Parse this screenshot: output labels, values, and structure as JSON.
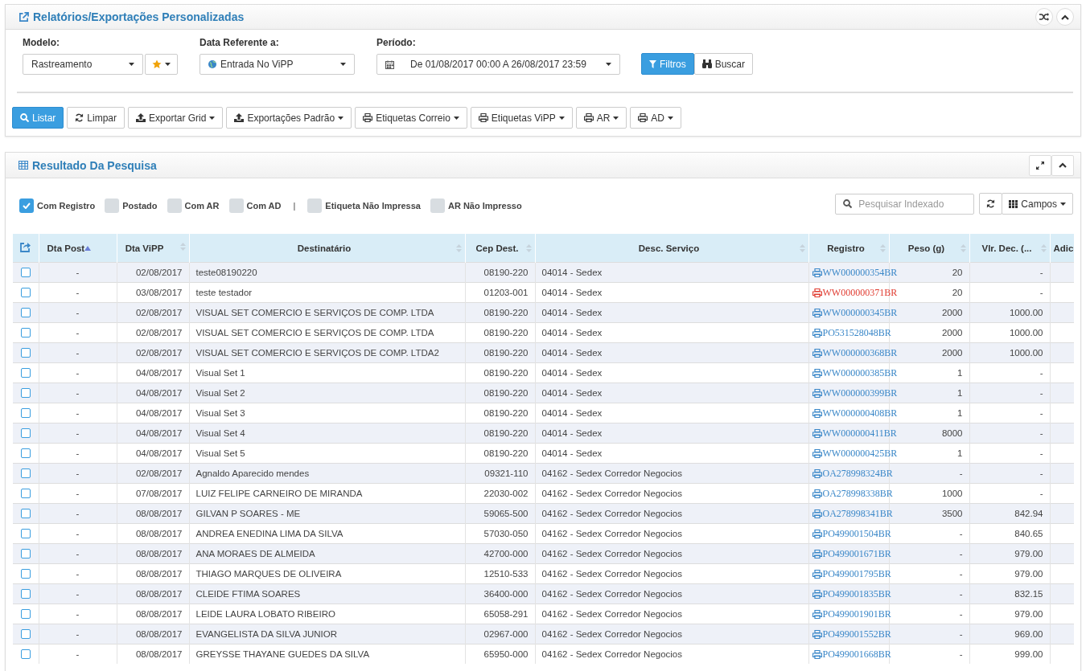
{
  "report_panel": {
    "title": "Relatórios/Exportações Personalizadas",
    "fields": [
      {
        "label": "Modelo:",
        "value": "Rastreamento"
      },
      {
        "label": "Data Referente a:",
        "value": "Entrada No ViPP"
      },
      {
        "label": "Período:",
        "value": "De 01/08/2017 00:00 A 26/08/2017 23:59"
      }
    ],
    "filter_buttons": [
      {
        "label": "Filtros",
        "active": true
      },
      {
        "label": "Buscar",
        "active": false
      }
    ],
    "toolbar": [
      {
        "label": "Listar",
        "active": true,
        "caret": false
      },
      {
        "label": "Limpar",
        "active": false,
        "caret": false
      },
      {
        "label": "Exportar Grid",
        "active": false,
        "caret": true
      },
      {
        "label": "Exportações Padrão",
        "active": false,
        "caret": true
      },
      {
        "label": "Etiquetas Correio",
        "active": false,
        "caret": true
      },
      {
        "label": "Etiquetas ViPP",
        "active": false,
        "caret": true
      },
      {
        "label": "AR",
        "active": false,
        "caret": true
      },
      {
        "label": "AD",
        "active": false,
        "caret": true
      }
    ]
  },
  "result_panel": {
    "title": "Resultado Da Pesquisa",
    "filters": [
      {
        "kind": "checkbox",
        "label": "Com Registro",
        "checked": true
      },
      {
        "kind": "checkbox",
        "label": "Postado",
        "checked": false
      },
      {
        "kind": "checkbox",
        "label": "Com AR",
        "checked": false
      },
      {
        "kind": "checkbox",
        "label": "Com AD",
        "checked": false
      },
      {
        "kind": "separator",
        "label": "|"
      },
      {
        "kind": "checkbox",
        "label": "Etiqueta Não Impressa",
        "checked": false
      },
      {
        "kind": "checkbox",
        "label": "AR Não Impresso",
        "checked": false
      }
    ],
    "search": {
      "placeholder": "Pesquisar Indexado"
    },
    "fields_button": "Campos",
    "table": {
      "columns": [
        {
          "label": "Dta Post",
          "sorted": true
        },
        {
          "label": "Dta ViPP",
          "sorted": false
        },
        {
          "label": "Destinatário",
          "sorted": false
        },
        {
          "label": "Cep Dest.",
          "sorted": false
        },
        {
          "label": "Desc. Serviço",
          "sorted": false
        },
        {
          "label": "Registro",
          "sorted": false
        },
        {
          "label": "Peso (g)",
          "sorted": false
        },
        {
          "label": "Vlr. Dec. (...",
          "sorted": false
        },
        {
          "label": "Adic",
          "sorted": false
        }
      ],
      "rows": [
        {
          "checked": false,
          "dta_post": "-",
          "dta_vipp": "02/08/2017",
          "destinatario": "teste08190220",
          "cep": "08190-220",
          "servico": "04014 - Sedex",
          "registro": "WW000000354BR",
          "color": "#3a87c8",
          "peso": "20",
          "valor": "-"
        },
        {
          "checked": false,
          "dta_post": "-",
          "dta_vipp": "03/08/2017",
          "destinatario": "teste testador",
          "cep": "01203-001",
          "servico": "04014 - Sedex",
          "registro": "WW000000371BR",
          "color": "#e03c31",
          "peso": "20",
          "valor": "-"
        },
        {
          "checked": false,
          "dta_post": "-",
          "dta_vipp": "02/08/2017",
          "destinatario": "VISUAL SET COMERCIO E SERVIÇOS DE COMP. LTDA",
          "cep": "08190-220",
          "servico": "04014 - Sedex",
          "registro": "WW000000345BR",
          "color": "#3a87c8",
          "peso": "2000",
          "valor": "1000.00"
        },
        {
          "checked": false,
          "dta_post": "-",
          "dta_vipp": "02/08/2017",
          "destinatario": "VISUAL SET COMERCIO E SERVIÇOS DE COMP. LTDA",
          "cep": "08190-220",
          "servico": "04014 - Sedex",
          "registro": "PO531528048BR",
          "color": "#3a87c8",
          "peso": "2000",
          "valor": "1000.00"
        },
        {
          "checked": false,
          "dta_post": "-",
          "dta_vipp": "02/08/2017",
          "destinatario": "VISUAL SET COMERCIO E SERVIÇOS DE COMP. LTDA2",
          "cep": "08190-220",
          "servico": "04014 - Sedex",
          "registro": "WW000000368BR",
          "color": "#3a87c8",
          "peso": "2000",
          "valor": "1000.00"
        },
        {
          "checked": false,
          "dta_post": "-",
          "dta_vipp": "04/08/2017",
          "destinatario": "Visual Set 1",
          "cep": "08190-220",
          "servico": "04014 - Sedex",
          "registro": "WW000000385BR",
          "color": "#3a87c8",
          "peso": "1",
          "valor": "-"
        },
        {
          "checked": false,
          "dta_post": "-",
          "dta_vipp": "04/08/2017",
          "destinatario": "Visual Set 2",
          "cep": "08190-220",
          "servico": "04014 - Sedex",
          "registro": "WW000000399BR",
          "color": "#3a87c8",
          "peso": "1",
          "valor": "-"
        },
        {
          "checked": false,
          "dta_post": "-",
          "dta_vipp": "04/08/2017",
          "destinatario": "Visual Set 3",
          "cep": "08190-220",
          "servico": "04014 - Sedex",
          "registro": "WW000000408BR",
          "color": "#3a87c8",
          "peso": "1",
          "valor": "-"
        },
        {
          "checked": false,
          "dta_post": "-",
          "dta_vipp": "04/08/2017",
          "destinatario": "Visual Set 4",
          "cep": "08190-220",
          "servico": "04014 - Sedex",
          "registro": "WW000000411BR",
          "color": "#3a87c8",
          "peso": "8000",
          "valor": "-"
        },
        {
          "checked": false,
          "dta_post": "-",
          "dta_vipp": "04/08/2017",
          "destinatario": "Visual Set 5",
          "cep": "08190-220",
          "servico": "04014 - Sedex",
          "registro": "WW000000425BR",
          "color": "#3a87c8",
          "peso": "1",
          "valor": "-"
        },
        {
          "checked": false,
          "dta_post": "-",
          "dta_vipp": "02/08/2017",
          "destinatario": "Agnaldo Aparecido mendes",
          "cep": "09321-110",
          "servico": "04162 - Sedex Corredor Negocios",
          "registro": "OA278998324BR",
          "color": "#3a87c8",
          "peso": "-",
          "valor": "-"
        },
        {
          "checked": false,
          "dta_post": "-",
          "dta_vipp": "07/08/2017",
          "destinatario": "LUIZ FELIPE CARNEIRO DE MIRANDA",
          "cep": "22030-002",
          "servico": "04162 - Sedex Corredor Negocios",
          "registro": "OA278998338BR",
          "color": "#3a87c8",
          "peso": "1000",
          "valor": "-"
        },
        {
          "checked": false,
          "dta_post": "-",
          "dta_vipp": "08/08/2017",
          "destinatario": "GILVAN P SOARES - ME",
          "cep": "59065-500",
          "servico": "04162 - Sedex Corredor Negocios",
          "registro": "OA278998341BR",
          "color": "#3a87c8",
          "peso": "3500",
          "valor": "842.94"
        },
        {
          "checked": false,
          "dta_post": "-",
          "dta_vipp": "08/08/2017",
          "destinatario": "ANDREA ENEDINA LIMA DA SILVA",
          "cep": "57030-050",
          "servico": "04162 - Sedex Corredor Negocios",
          "registro": "PO499001504BR",
          "color": "#3a87c8",
          "peso": "-",
          "valor": "840.65"
        },
        {
          "checked": false,
          "dta_post": "-",
          "dta_vipp": "08/08/2017",
          "destinatario": "ANA MORAES DE ALMEIDA",
          "cep": "42700-000",
          "servico": "04162 - Sedex Corredor Negocios",
          "registro": "PO499001671BR",
          "color": "#3a87c8",
          "peso": "-",
          "valor": "979.00"
        },
        {
          "checked": false,
          "dta_post": "-",
          "dta_vipp": "08/08/2017",
          "destinatario": "THIAGO MARQUES DE OLIVEIRA",
          "cep": "12510-533",
          "servico": "04162 - Sedex Corredor Negocios",
          "registro": "PO499001795BR",
          "color": "#3a87c8",
          "peso": "-",
          "valor": "979.00"
        },
        {
          "checked": false,
          "dta_post": "-",
          "dta_vipp": "08/08/2017",
          "destinatario": "CLEIDE FTIMA SOARES",
          "cep": "36400-000",
          "servico": "04162 - Sedex Corredor Negocios",
          "registro": "PO499001835BR",
          "color": "#3a87c8",
          "peso": "-",
          "valor": "832.15"
        },
        {
          "checked": false,
          "dta_post": "-",
          "dta_vipp": "08/08/2017",
          "destinatario": "LEIDE LAURA LOBATO RIBEIRO",
          "cep": "65058-291",
          "servico": "04162 - Sedex Corredor Negocios",
          "registro": "PO499001901BR",
          "color": "#3a87c8",
          "peso": "-",
          "valor": "979.00"
        },
        {
          "checked": false,
          "dta_post": "-",
          "dta_vipp": "08/08/2017",
          "destinatario": "EVANGELISTA DA SILVA JUNIOR",
          "cep": "02967-000",
          "servico": "04162 - Sedex Corredor Negocios",
          "registro": "PO499001552BR",
          "color": "#3a87c8",
          "peso": "-",
          "valor": "969.00"
        },
        {
          "checked": false,
          "dta_post": "-",
          "dta_vipp": "08/08/2017",
          "destinatario": "GREYSSE THAYANE GUEDES DA SILVA",
          "cep": "65950-000",
          "servico": "04162 - Sedex Corredor Negocios",
          "registro": "PO499001668BR",
          "color": "#3a87c8",
          "peso": "-",
          "valor": "999.00"
        }
      ]
    }
  }
}
